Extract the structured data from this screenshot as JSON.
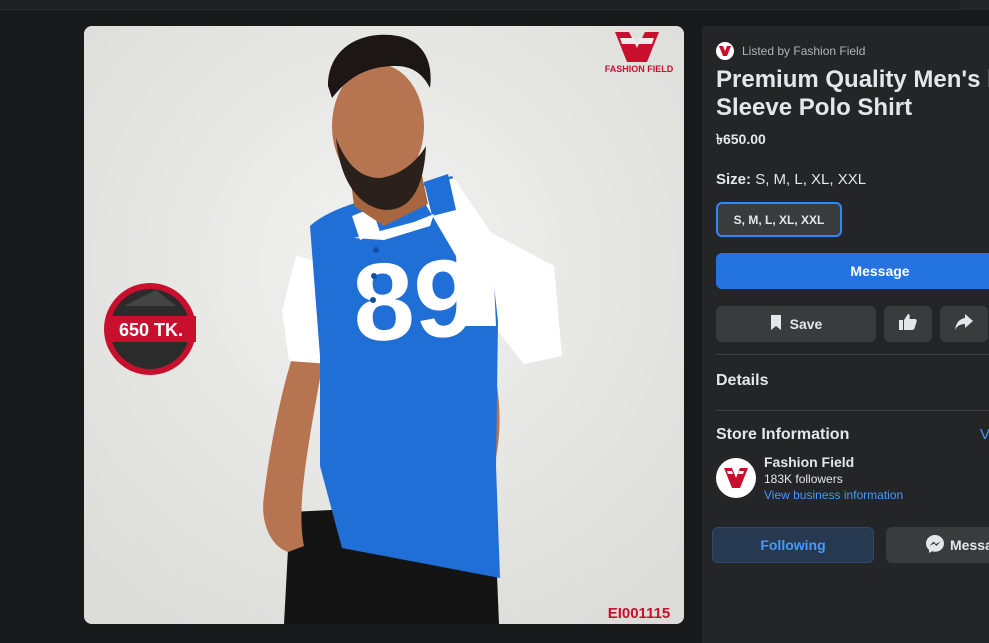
{
  "photo": {
    "brand_name": "FASHION FIELD",
    "price_badge": "650 TK.",
    "jersey_number": "89",
    "product_code": "EI001115"
  },
  "listing": {
    "listed_by": "Listed by Fashion Field",
    "title_line1": "Premium Quality Men's l",
    "title_line2": "Sleeve Polo Shirt",
    "price": "৳650.00",
    "size_label": "Size:",
    "size_value": "S, M, L, XL, XXL",
    "size_chip": "S, M, L, XL, XXL"
  },
  "actions": {
    "message": "Message",
    "save": "Save"
  },
  "sections": {
    "details": "Details",
    "store_information": "Store Information",
    "store_link_partial": "V"
  },
  "store": {
    "name": "Fashion Field",
    "followers": "183K followers",
    "view_info": "View business information",
    "following": "Following",
    "message_partial": "Messa"
  },
  "colors": {
    "accent": "#2374e1",
    "link": "#4599ff",
    "brand_red": "#c8102e",
    "shirt_blue": "#1f6fd6"
  }
}
